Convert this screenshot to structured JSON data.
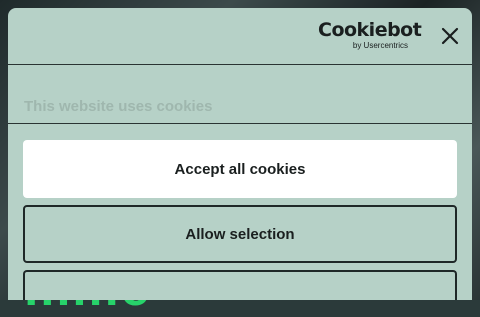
{
  "dialog": {
    "logo": {
      "name": "Cookiebot",
      "byline": "by Usercentrics"
    },
    "close_icon": "close-icon",
    "notice_title": "This website uses cookies",
    "buttons": {
      "accept_all": "Accept all cookies",
      "allow_selection": "Allow selection"
    }
  },
  "background": {
    "text": "mme"
  }
}
